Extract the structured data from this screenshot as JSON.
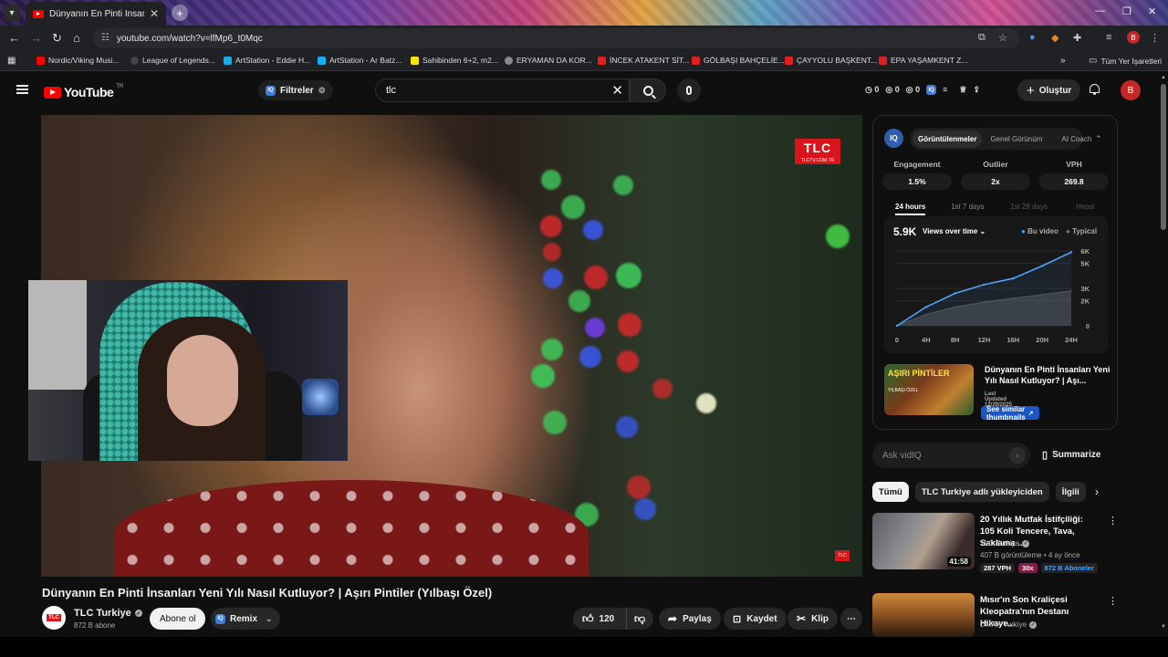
{
  "browser": {
    "tab_title": "Dünyanın En Pinti İnsanları Yeni Yılı Nasıl Kutluyor? | Aşırı Pintiler (Yılbaşı Özel) - YouTube",
    "url": "youtube.com/watch?v=lfMp6_t0Mqc",
    "bookmarks": [
      {
        "label": "Nordic/Viking Musi...",
        "color": "#ff0000"
      },
      {
        "label": "League of Legends...",
        "color": "#444444"
      },
      {
        "label": "ArtStation - Eddie H...",
        "color": "#13aff0"
      },
      {
        "label": "ArtStation - Ar Batz...",
        "color": "#13aff0"
      },
      {
        "label": "Sahibinden 6+2, m2...",
        "color": "#ffe800"
      },
      {
        "label": "ERYAMAN DA KOR...",
        "color": "#888888"
      },
      {
        "label": "İNCEK ATAKENT SİT...",
        "color": "#e02020"
      },
      {
        "label": "GÖLBAŞI BAHÇELİE...",
        "color": "#e02020"
      },
      {
        "label": "ÇAYYOLU BAŞKENT...",
        "color": "#e02020"
      },
      {
        "label": "EPA YAŞAMKENT Z...",
        "color": "#e02020"
      }
    ],
    "all_bookmarks": "Tüm Yer İşaretleri",
    "profile_letter": "B"
  },
  "header": {
    "logo_text": "YouTube",
    "logo_region": "TR",
    "filter_label": "Filtreler",
    "search_value": "tlc",
    "counters": [
      "0",
      "0",
      "0"
    ],
    "create_label": "Oluştur",
    "avatar_letter": "B"
  },
  "video": {
    "title": "Dünyanın En Pinti İnsanları Yeni Yılı Nasıl Kutluyor? | Aşırı Pintiler (Yılbaşı Özel)",
    "watermark": "TLC",
    "watermark_url": "TLCTV.COM.TR",
    "channel_logo": "TLC",
    "channel_name": "TLC Turkiye",
    "subscribers": "872 B abone",
    "subscribe_label": "Abone ol",
    "remix_label": "Remix",
    "likes": "120",
    "share_label": "Paylaş",
    "save_label": "Kaydet",
    "clip_label": "Klip"
  },
  "vidiq": {
    "logo": "IQ",
    "tabs": [
      "Görüntülenmeler",
      "Genel Görünüm",
      "AI Coach"
    ],
    "stats": [
      {
        "label": "Engagement",
        "value": "1.5%"
      },
      {
        "label": "Outlier",
        "value": "2x"
      },
      {
        "label": "VPH",
        "value": "269.8"
      }
    ],
    "periods": [
      "24 hours",
      "1st 7 days",
      "1st 28 days",
      "Hepsi"
    ],
    "total_views": "5.9K",
    "views_dropdown": "Views over time",
    "legend_this": "Bu video",
    "legend_typical": "Typical",
    "thumb_text_1": "AŞIRI PİNTİLER",
    "thumb_text_2": "YILBAŞI ÖZEL",
    "video_title": "Dünyanın En Pinti İnsanları Yeni Yılı Nasıl Kutluyor? | Aşı...",
    "last_updated": "Last Updated 12/29/2025",
    "similar_label": "See similar thumbnails",
    "ask_placeholder": "Ask vidIQ",
    "summarize_label": "Summarize"
  },
  "chart_data": {
    "type": "area",
    "x": [
      "0",
      "4H",
      "8H",
      "12H",
      "16H",
      "20H",
      "24H"
    ],
    "yticks": [
      "0",
      "2K",
      "3K",
      "5K",
      "6K"
    ],
    "ylim": [
      0,
      6000
    ],
    "series": [
      {
        "name": "Bu video",
        "color": "#4aa3ff",
        "values": [
          0,
          1500,
          2600,
          3300,
          3800,
          4800,
          5900
        ]
      },
      {
        "name": "Typical",
        "color": "#555555",
        "values": [
          0,
          900,
          1500,
          1900,
          2200,
          2500,
          2800
        ]
      }
    ]
  },
  "chips": [
    "Tümü",
    "TLC Turkiye adlı yükleyiciden",
    "İlgili"
  ],
  "recommendations": [
    {
      "title": "20 Yıllık Mutfak İstifçiliği: 105 Koli Tencere, Tava, Saklama ...",
      "channel": "TLC Turkiye",
      "meta": "407 B görüntüleme • 4 ay önce",
      "duration": "41:58",
      "badges": [
        "287 VPH",
        "30x",
        "872 B Aboneler"
      ]
    },
    {
      "title": "Mısır'ın Son Kraliçesi Kleopatra'nın Destanı Hikaye...",
      "channel": "DMAX Turkiye",
      "meta": "",
      "duration": "",
      "badges": []
    }
  ]
}
